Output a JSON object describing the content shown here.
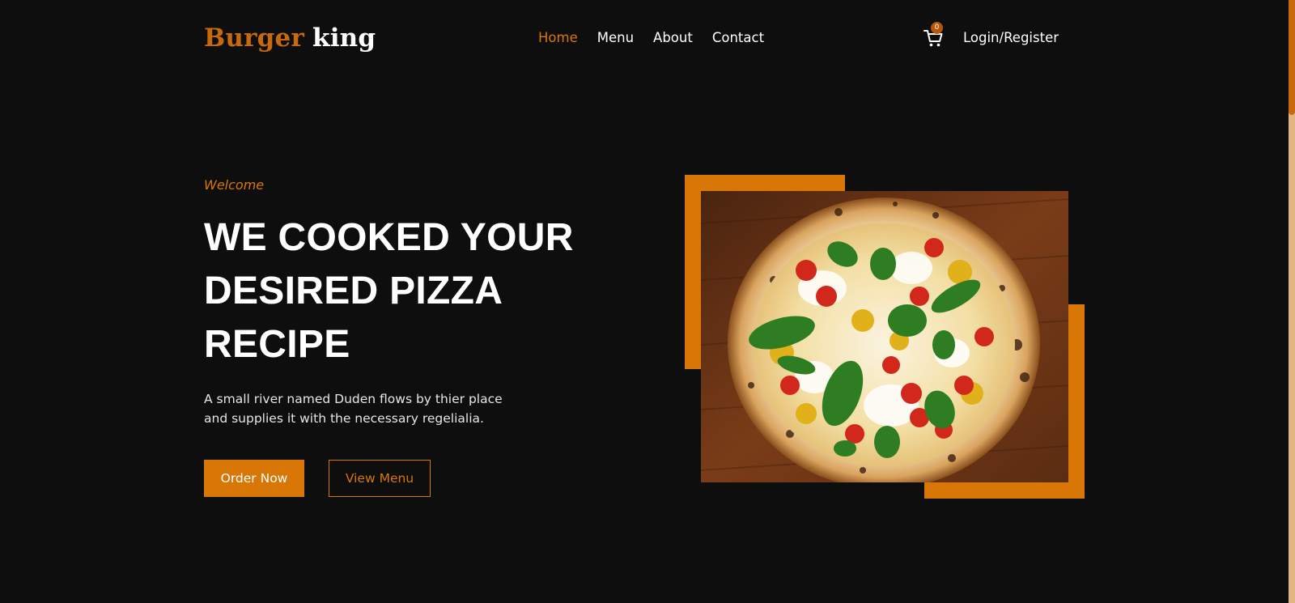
{
  "brand": {
    "part1": "Burger",
    "part2": "king"
  },
  "nav": {
    "items": [
      {
        "label": "Home",
        "active": true
      },
      {
        "label": "Menu",
        "active": false
      },
      {
        "label": "About",
        "active": false
      },
      {
        "label": "Contact",
        "active": false
      }
    ]
  },
  "cart": {
    "icon": "cart-icon",
    "count": "0"
  },
  "auth": {
    "label": "Login/Register"
  },
  "hero": {
    "eyebrow": "Welcome",
    "headline_lines": [
      "WE COOKED YOUR",
      "DESIRED PIZZA",
      "RECIPE"
    ],
    "description_lines": [
      "A small river named Duden flows by thier place",
      "and supplies it with the necessary regelialia."
    ],
    "primary_button": "Order Now",
    "secondary_button": "View Menu"
  },
  "theme": {
    "accent": "#d97706",
    "background": "#0e0e0f",
    "text": "#ffffff"
  }
}
